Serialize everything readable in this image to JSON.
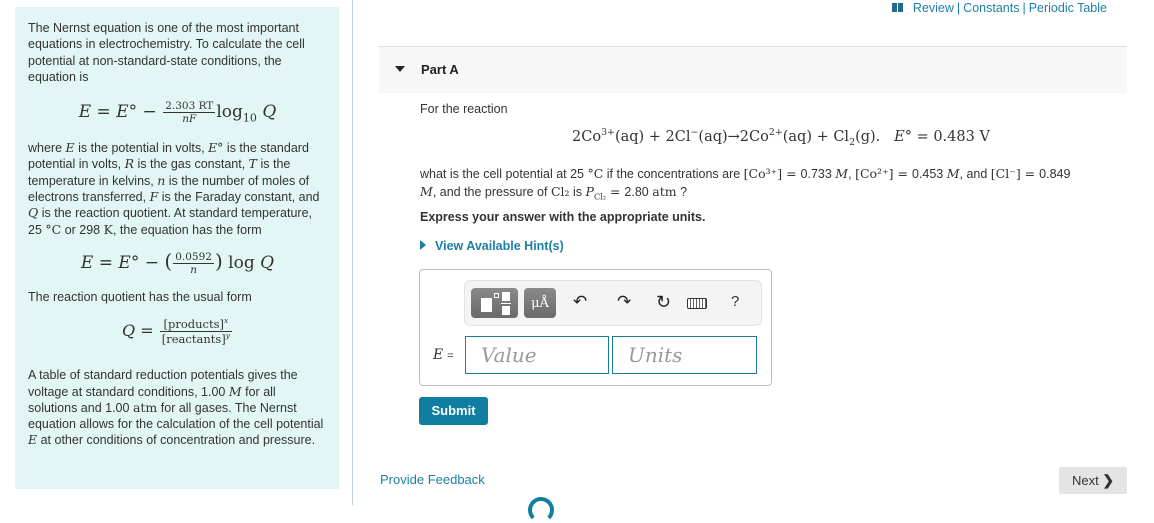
{
  "top_links": {
    "icon": "book-icon",
    "review": "Review",
    "constants": "Constants",
    "periodic_table": "Periodic Table",
    "separator": "|"
  },
  "intro": {
    "p1": "The Nernst equation is one of the most important equations in electrochemistry. To calculate the cell potential at non-standard-state conditions, the equation is",
    "eq1": {
      "lhs": "E",
      "eq": "=",
      "e0": "E°",
      "minus": "−",
      "num": "2.303 RT",
      "den": "nF",
      "log": "log",
      "log_sub": "10",
      "q": "Q"
    },
    "p2": {
      "t1": "where ",
      "E": "E",
      "t2": " is the potential in volts, ",
      "E0": "E°",
      "t3": " is the standard potential in volts, ",
      "R": "R",
      "t4": " is the gas constant, ",
      "T": "T",
      "t5": " is the temperature in kelvins, ",
      "n": "n",
      "t6": " is the number of moles of electrons transferred, ",
      "F": "F",
      "t7": " is the Faraday constant, and ",
      "Q": "Q",
      "t8": " is the reaction quotient. At standard temperature, 25 ",
      "degC": "°C",
      "t9": " or 298 ",
      "K": "K",
      "t10": ", the equation has the form"
    },
    "eq2": {
      "lhs": "E",
      "eq": "=",
      "e0": "E°",
      "minus": "−",
      "num": "0.0592",
      "den": "n",
      "log": "log",
      "q": "Q"
    },
    "p3": "The reaction quotient has the usual form",
    "eq3": {
      "lhs": "Q",
      "eq": "=",
      "num": "[products]",
      "num_sup": "x",
      "den": "[reactants]",
      "den_sup": "y"
    },
    "p4": {
      "t1": "A table of standard reduction potentials gives the voltage at standard conditions, 1.00 ",
      "M": "M",
      "t2": " for all solutions and 1.00 ",
      "atm": "atm",
      "t3": " for all gases. The Nernst equation allows for the calculation of the cell potential ",
      "E": "E",
      "t4": " at other conditions of concentration and pressure."
    }
  },
  "part": {
    "title": "Part A",
    "for_reaction": "For the reaction",
    "reaction": {
      "c1": "2Co",
      "c1_sup": "3+",
      "c1_state": "(aq) + 2Cl",
      "c2_sup": "−",
      "c2_state": "(aq)→2Co",
      "c3_sup": "2+",
      "c3_state": "(aq) + Cl",
      "c4_sub": "2",
      "c4_state": "(g).",
      "e0": "E°",
      "e0_val": " = 0.483 V"
    },
    "question": {
      "t1": "what is the cell potential at 25 ",
      "degC": "°C",
      "t2": " if the concentrations are ",
      "co3": "[Co³⁺] = ",
      "co3_val": "0.733",
      "M": "M",
      "co2": "[Co²⁺] = ",
      "co2_val": "0.453",
      "and": ", and ",
      "cl": "[Cl⁻] = ",
      "cl_val": "0.849",
      "t3": ", and the pressure of ",
      "cl2": "Cl₂",
      "is": " is ",
      "pcl2": "P",
      "pcl2_sub": "Cl₂",
      "p_eq": " = ",
      "p_val": "2.80",
      "atm": "atm",
      "qmark": " ?"
    },
    "express": "Express your answer with the appropriate units.",
    "hints": "View Available Hint(s)"
  },
  "answer": {
    "toolbar": {
      "templates": "templates-icon",
      "units_label": "μÅ",
      "undo": "↶",
      "redo": "↷",
      "reset": "↻",
      "keyboard": "keyboard-icon",
      "help": "?"
    },
    "label_var": "E",
    "label_eq": "=",
    "value_placeholder": "Value",
    "units_placeholder": "Units"
  },
  "actions": {
    "submit": "Submit",
    "feedback": "Provide Feedback",
    "next": "Next",
    "next_chevron": "❯"
  }
}
